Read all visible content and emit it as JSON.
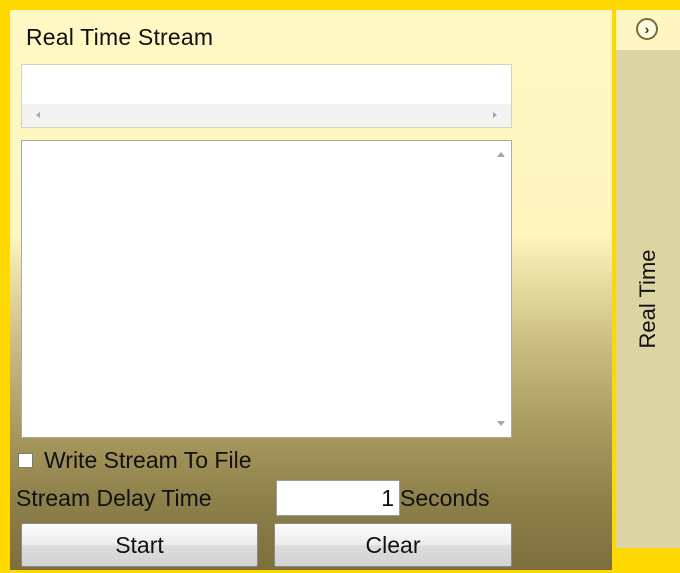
{
  "panel": {
    "title": "Real Time Stream",
    "write_to_file_label": "Write Stream To File",
    "delay_label": "Stream Delay Time",
    "delay_value": "1",
    "delay_unit": "Seconds",
    "start_label": "Start",
    "clear_label": "Clear"
  },
  "sidebar": {
    "tab_label": "Real Time",
    "expand_icon": "chevron-right-circle-icon"
  },
  "colors": {
    "frame": "#ffd800",
    "panel_top": "#fff8c4",
    "panel_bottom": "#7d6f3c",
    "side_tab": "#ddd4a3"
  }
}
